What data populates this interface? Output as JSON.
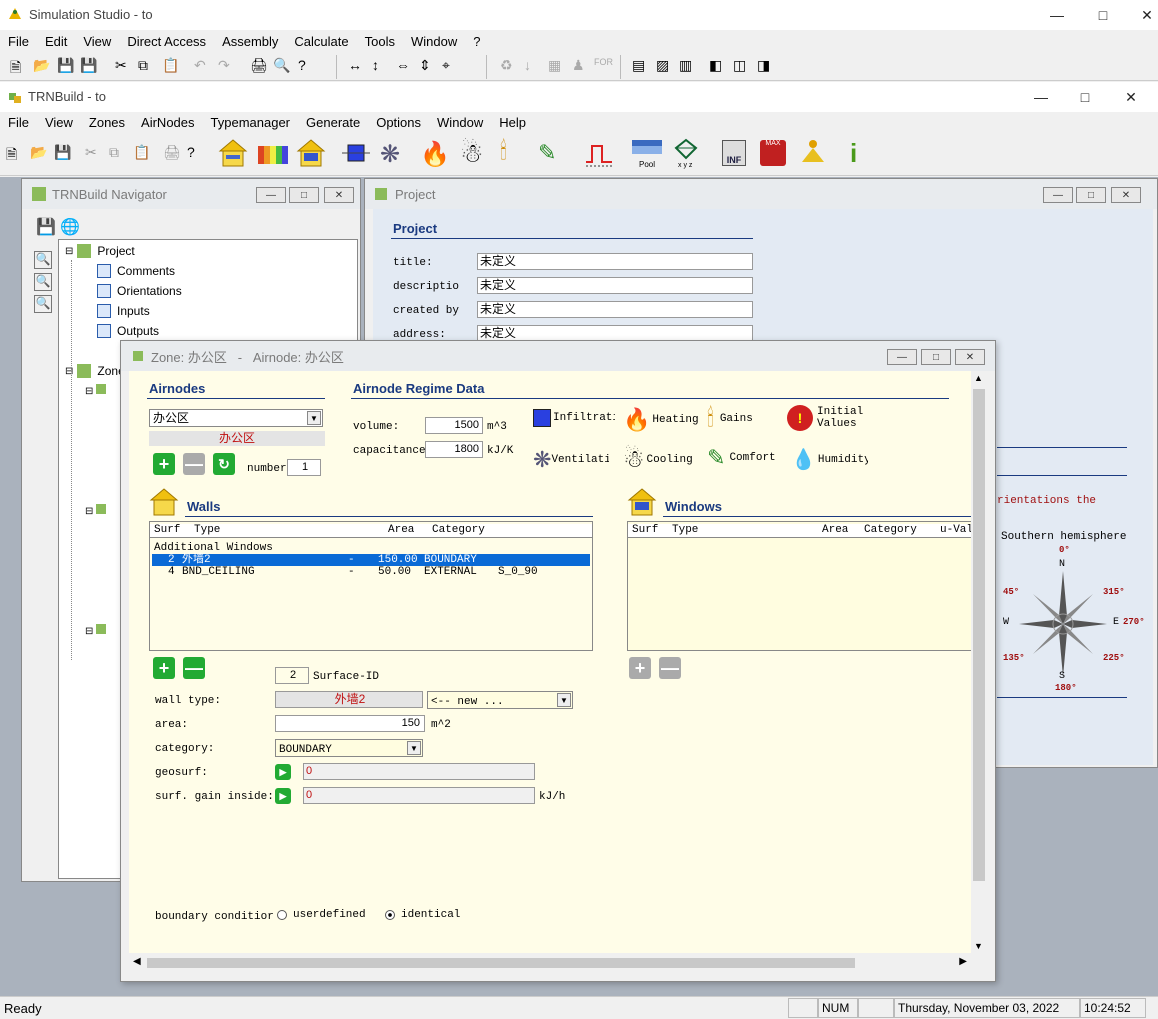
{
  "studio": {
    "title": "Simulation Studio - to",
    "menu": [
      "File",
      "Edit",
      "View",
      "Direct Access",
      "Assembly",
      "Calculate",
      "Tools",
      "Window",
      "?"
    ]
  },
  "trnbuild": {
    "title": "TRNBuild - to",
    "menu": [
      "File",
      "View",
      "Zones",
      "AirNodes",
      "Typemanager",
      "Generate",
      "Options",
      "Window",
      "Help"
    ],
    "toolbar_labels": {
      "pool": "Pool",
      "xyz": "x y z",
      "inf": "INF",
      "max": "MAX"
    }
  },
  "navigator": {
    "title": "TRNBuild Navigator",
    "root": "Project",
    "items": [
      "Comments",
      "Orientations",
      "Inputs",
      "Outputs"
    ],
    "zones_label": "Zone"
  },
  "project": {
    "title": "Project",
    "heading": "Project",
    "fields": [
      {
        "label": "title:",
        "value": "未定义"
      },
      {
        "label": "descriptio",
        "value": "未定义"
      },
      {
        "label": "created by",
        "value": "未定义"
      },
      {
        "label": "address:",
        "value": "未定义"
      }
    ],
    "orientation_text": "rientations the",
    "hemisphere": "Southern hemisphere",
    "compass": {
      "n": "N",
      "s": "S",
      "e": "E",
      "w": "W",
      "deg0": "0°",
      "deg45": "45°",
      "deg315": "315°",
      "deg270": "270°",
      "deg135": "135°",
      "deg225": "225°",
      "deg180": "180°"
    }
  },
  "zone": {
    "title": "Zone: 办公区   -   Airnode: 办公区",
    "airnodes_heading": "Airnodes",
    "airnode_select": "办公区",
    "airnode_name": "办公区",
    "number_label": "number:",
    "number_value": "1",
    "regime_heading": "Airnode Regime Data",
    "volume_label": "volume:",
    "volume_value": "1500",
    "volume_unit": "m^3",
    "capacitance_label": "capacitance:",
    "capacitance_value": "1800",
    "capacitance_unit": "kJ/K",
    "regime_buttons": [
      "Infiltratio",
      "Heating",
      "Gains",
      "Initial Values",
      "Ventilatio",
      "Cooling",
      "Comfort",
      "Humidity"
    ],
    "walls": {
      "heading": "Walls",
      "columns": [
        "Surf",
        "Type",
        "Area",
        "Category"
      ],
      "group": "Additional Windows",
      "rows": [
        {
          "surf": "2",
          "type": "外墙2",
          "dash": "-",
          "area": "150.00",
          "category": "BOUNDARY",
          "extra": ""
        },
        {
          "surf": "4",
          "type": "BND_CEILING",
          "dash": "-",
          "area": "50.00",
          "category": "EXTERNAL",
          "extra": "S_0_90"
        }
      ]
    },
    "windows": {
      "heading": "Windows",
      "columns": [
        "Surf",
        "Type",
        "Area",
        "Category",
        "u-Val"
      ]
    },
    "surface_id_value": "2",
    "surface_id_label": "Surface-ID",
    "wall_type_label": "wall type:",
    "wall_type_value": "外墙2",
    "wall_type_new": "<-- new ...",
    "area_label": "area:",
    "area_value": "150",
    "area_unit": "m^2",
    "category_label": "category:",
    "category_value": "BOUNDARY",
    "geosurf_label": "geosurf:",
    "geosurf_value": "0",
    "gain_label": "surf. gain inside:",
    "gain_value": "0",
    "gain_unit": "kJ/h",
    "boundary_label": "boundary conditior",
    "radio_userdefined": "userdefined",
    "radio_identical": "identical"
  },
  "status": {
    "ready": "Ready",
    "num": "NUM",
    "date": "Thursday, November 03, 2022",
    "time": "10:24:52"
  }
}
